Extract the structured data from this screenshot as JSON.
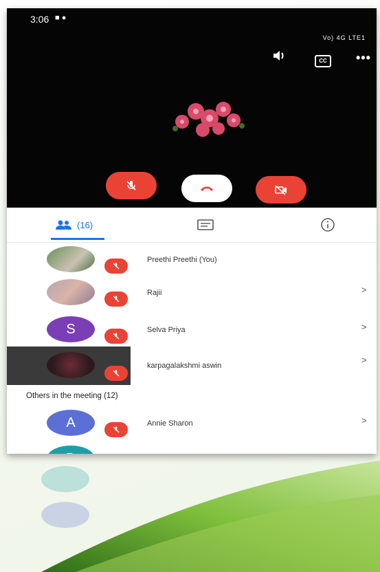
{
  "status": {
    "time": "3:06",
    "right_indicators": "Vo) 4G LTE1"
  },
  "call": {
    "controls": [
      "mute-mic",
      "end-call",
      "camera-off"
    ]
  },
  "tabs": {
    "people_count": "(16)"
  },
  "participants": [
    {
      "name": "Preethi Preethi (You)",
      "avatar": "photo"
    },
    {
      "name": "Rajii",
      "avatar": "photo"
    },
    {
      "name": "Selva Priya",
      "avatar_letter": "S",
      "color": "#7b3fb5"
    },
    {
      "name": "karpagalakshmi aswin",
      "avatar": "flower"
    }
  ],
  "others": {
    "label": "Others in the meeting (12)",
    "items": [
      {
        "name": "Annie Sharon",
        "avatar_letter": "A",
        "color": "#5b6fd6"
      },
      {
        "name": "",
        "avatar_letter": "D",
        "color": "#1e9fa8"
      }
    ]
  },
  "chevron": ">",
  "colors": {
    "accent": "#1a73e8",
    "danger": "#ea4335",
    "call_bg": "#050505"
  }
}
